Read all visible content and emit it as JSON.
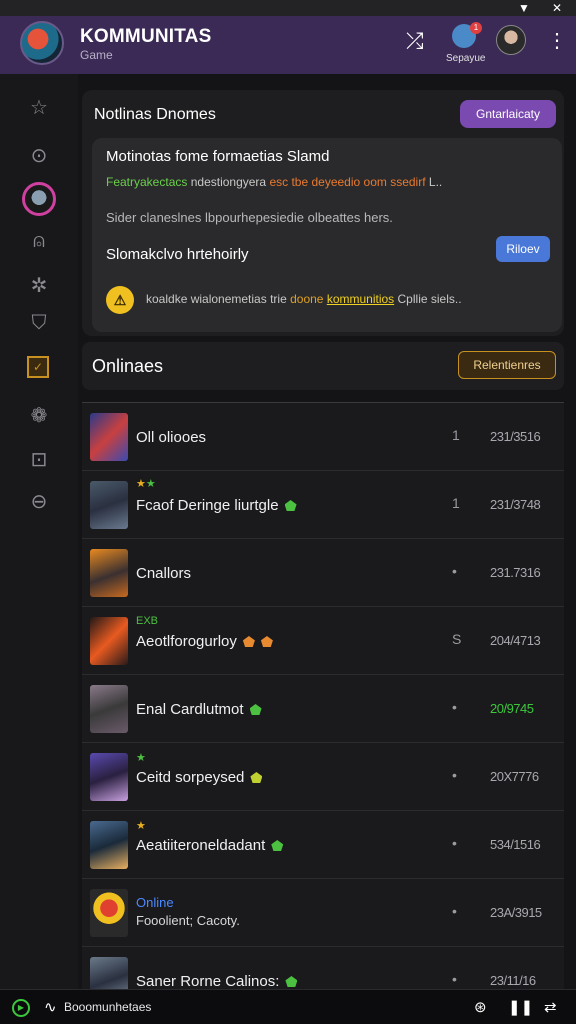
{
  "status_bar": {
    "wifi_icon": "wifi-icon",
    "close_glyph": "✕"
  },
  "header": {
    "title": "KOMMUNITAS",
    "subtitle": "Game",
    "user_label": "Sepayue",
    "notification_badge": "1"
  },
  "notifications": {
    "title": "Notlinas Dnomes",
    "action_label": "Gntarlaicaty",
    "card": {
      "heading": "Motinotas fome formaetias Slamd",
      "line_green": "Featryakectacs",
      "line_white": "ndestiongyera",
      "line_orange": "esc tbe deyeedio oom ssedirf",
      "line_tail": "L..",
      "description": "Sider claneslnes lbpourhepesiedie olbeattes hers.",
      "subheading": "Slomakclvo hrtehoirly",
      "subheading_button": "Riloev",
      "footer_text": "koaldke wialonemetias trie",
      "footer_link_1": "doone",
      "footer_link_2": "kommunitios",
      "footer_tail": "Cpllie siels.."
    }
  },
  "online": {
    "title": "Onlinaes",
    "action_label": "Relentienres",
    "rows": [
      {
        "tag": "",
        "name": "Oll oliooes",
        "status": "",
        "count": "1",
        "value": "231/3516",
        "value_color": "gray"
      },
      {
        "tag": "",
        "name": "Fcaof Deringe liurtgle",
        "status": "",
        "count": "1",
        "value": "231/3748",
        "value_color": "gray"
      },
      {
        "tag": "",
        "name": "Cnallors",
        "status": "",
        "count": "•",
        "value": "231.7316",
        "value_color": "gray"
      },
      {
        "tag": "EXB",
        "name": "Aeotlforogurloy",
        "status": "",
        "count": "S",
        "value": "204/4713",
        "value_color": "gray"
      },
      {
        "tag": "",
        "name": "Enal Cardlutmot",
        "status": "",
        "count": "•",
        "value": "20/9745",
        "value_color": "green"
      },
      {
        "tag": "",
        "name": "Ceitd sorpeysed",
        "status": "",
        "count": "•",
        "value": "20X7776",
        "value_color": "gray"
      },
      {
        "tag": "",
        "name": "Aeatiiteroneldadant",
        "status": "",
        "count": "•",
        "value": "534/1516",
        "value_color": "gray"
      },
      {
        "tag": "",
        "name": "",
        "status": "Online",
        "sub": "Fooolient; Cacoty.",
        "count": "•",
        "value": "23A/3915",
        "value_color": "gray"
      },
      {
        "tag": "",
        "name": "Saner Rorne Calinos:",
        "status": "",
        "count": "•",
        "value": "23/11/16",
        "value_color": "gray"
      }
    ]
  },
  "bottom_bar": {
    "label": "Booomunhetaes",
    "icons": [
      "play-icon",
      "waveform-icon",
      "gamepad-icon",
      "pause-icon",
      "shuffle-icon"
    ]
  },
  "colors": {
    "header_bg": "#3a2a55",
    "accent_purple": "#7a4ab0",
    "accent_blue": "#4a78d8",
    "accent_gold": "#c89020",
    "online_green": "#3cc83c"
  }
}
